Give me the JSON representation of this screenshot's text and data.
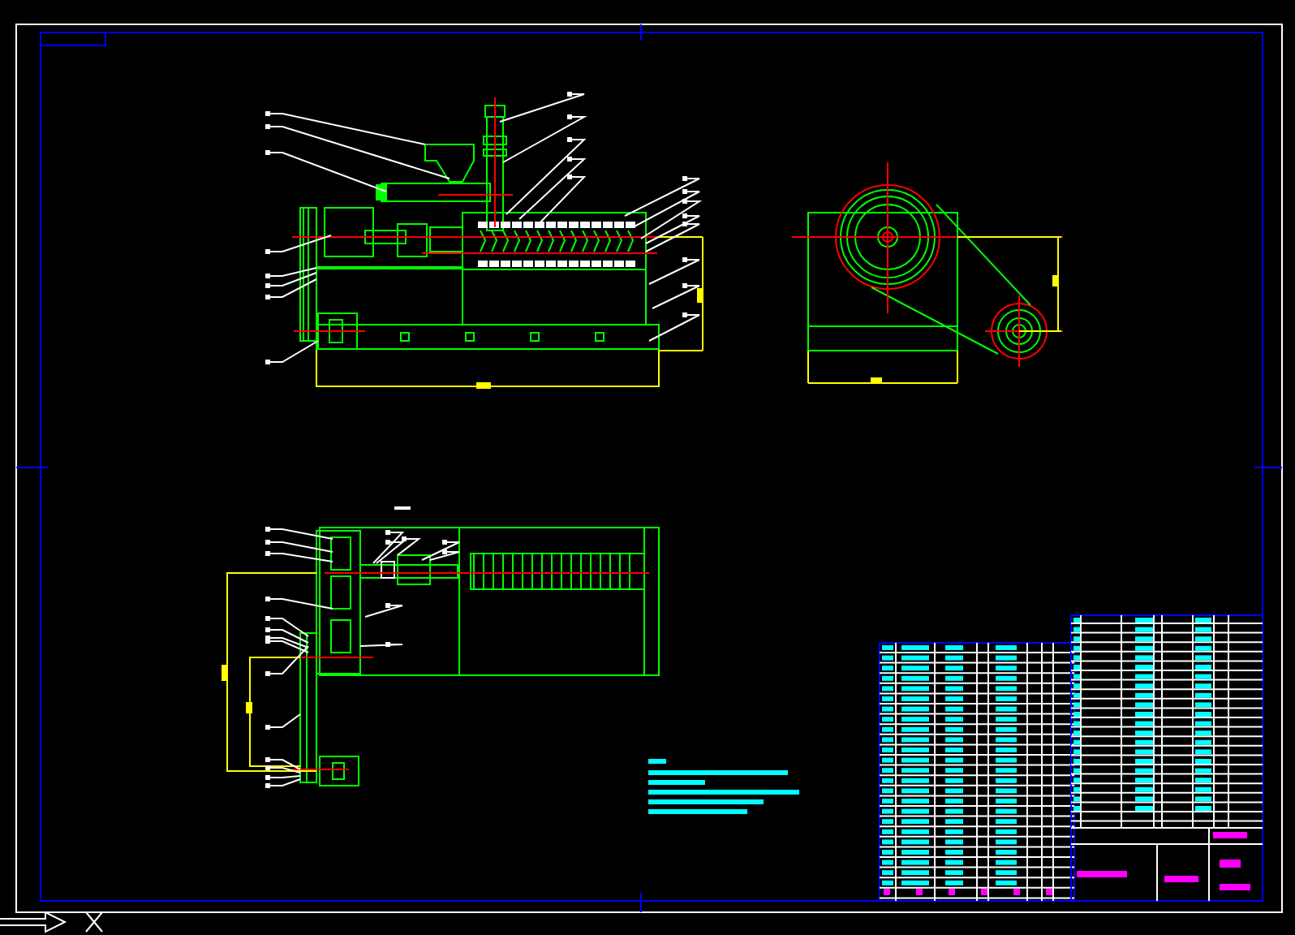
{
  "views": [
    {
      "kind": "side-elevation"
    },
    {
      "kind": "end-elevation"
    },
    {
      "kind": "plan"
    },
    {
      "kind": "notes"
    },
    {
      "kind": "parts-table"
    }
  ]
}
